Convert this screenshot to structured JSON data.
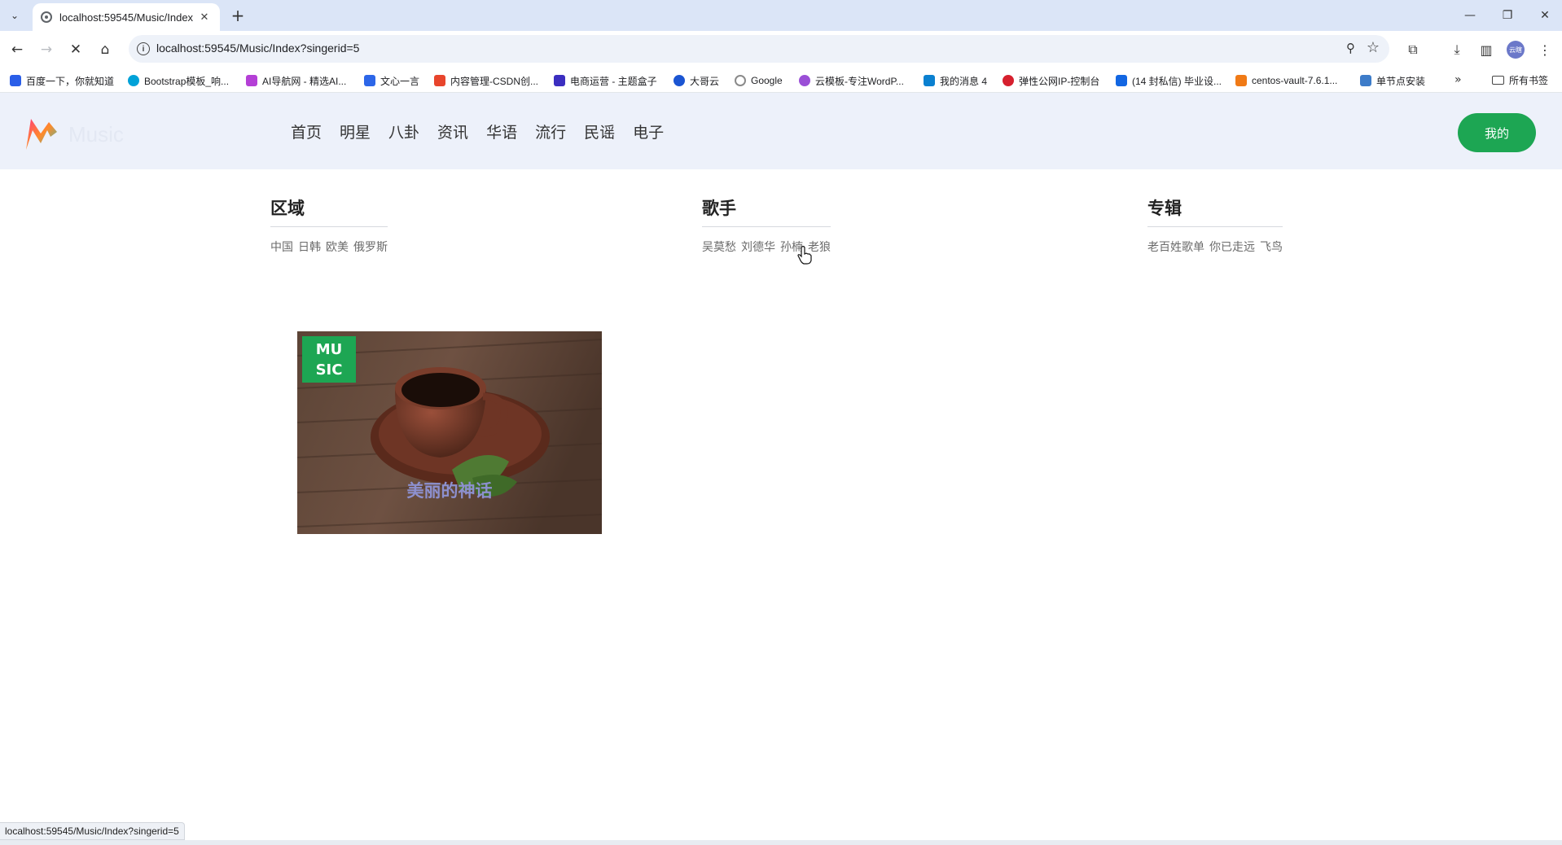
{
  "browser": {
    "tab_title": "localhost:59545/Music/Index",
    "url": "localhost:59545/Music/Index?singerid=5",
    "status_url": "localhost:59545/Music/Index?singerid=5",
    "profile_text": "云瞎",
    "bookmarks": [
      {
        "label": "百度一下，你就知道",
        "color": "#2a5ee8"
      },
      {
        "label": "Bootstrap模板_响...",
        "color": "#00a2d8"
      },
      {
        "label": "AI导航网 - 精选AI...",
        "color": "#b43fd6"
      },
      {
        "label": "文心一言",
        "color": "#2c66e8"
      },
      {
        "label": "内容管理-CSDN创...",
        "color": "#e8452c"
      },
      {
        "label": "电商运营 - 主题盒子",
        "color": "#3b2ec0"
      },
      {
        "label": "大哥云",
        "color": "#1b55d2"
      },
      {
        "label": "Google",
        "color": "#8a8a8a"
      },
      {
        "label": "云模板-专注WordP...",
        "color": "#9a4fd6"
      },
      {
        "label": "我的消息 4",
        "color": "#0a80d0"
      },
      {
        "label": "弹性公网IP-控制台",
        "color": "#d6202e"
      },
      {
        "label": "(14 封私信) 毕业设...",
        "color": "#1266e2"
      },
      {
        "label": "centos-vault-7.6.1...",
        "color": "#f07a16"
      },
      {
        "label": "单节点安装",
        "color": "#3d7cc9"
      }
    ],
    "bookmarks_all": "所有书签"
  },
  "site": {
    "logo_text": "Music",
    "nav": [
      "首页",
      "明星",
      "八卦",
      "资讯",
      "华语",
      "流行",
      "民谣",
      "电子"
    ],
    "mine_button": "我的",
    "filters": {
      "region": {
        "title": "区域",
        "items": [
          "中国",
          "日韩",
          "欧美",
          "俄罗斯"
        ]
      },
      "singer": {
        "title": "歌手",
        "items": [
          "吴莫愁",
          "刘德华",
          "孙楠",
          "老狼"
        ]
      },
      "album": {
        "title": "专辑",
        "items": [
          "老百姓歌单",
          "你已走远",
          "飞鸟"
        ]
      }
    },
    "cards": [
      {
        "badge": "MU SIC",
        "title": "美丽的神话"
      }
    ]
  },
  "colors": {
    "accent": "#1da653",
    "header_bg": "#edf1fa",
    "card_title": "#8d90cf"
  }
}
